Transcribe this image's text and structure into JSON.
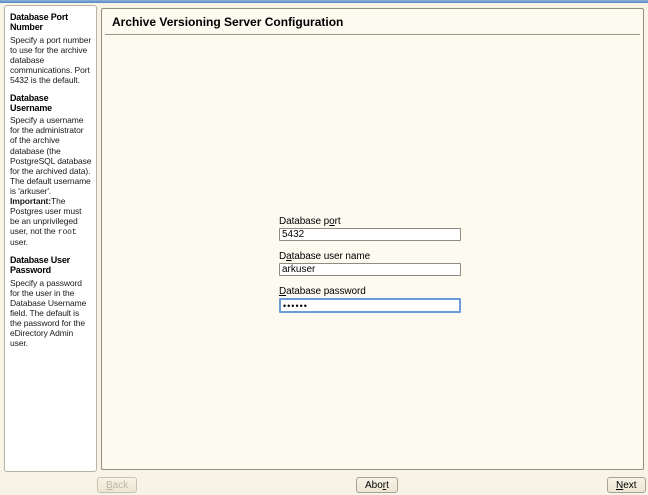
{
  "window": {
    "title": "Archive Versioning Server Configuration"
  },
  "colors": {
    "accent_blue": "#5585c0",
    "focus_border": "#6f9bdc",
    "panel_background": "#fdfaf0",
    "window_background": "#f7f3e7"
  },
  "sidebar": {
    "sections": [
      {
        "heading": "Database Port Number",
        "body": "Specify a port number to use for the archive database communications. Port 5432 is the default."
      },
      {
        "heading": "Database Username",
        "body_1": "Specify a username for the administrator of the archive database (the PostgreSQL database for the archived data). The default username is 'arkuser'. ",
        "important_label": "Important:",
        "body_2": "The Postgres user must be an unprivileged user, not the ",
        "code_word": "root",
        "body_3": " user."
      },
      {
        "heading": "Database User Password",
        "body": "Specify a password for the user in the Database Username field. The default is the password for the eDirectory Admin user."
      }
    ]
  },
  "form": {
    "port": {
      "label_pre": "Database p",
      "label_mnemonic": "o",
      "label_post": "rt",
      "value": "5432"
    },
    "username": {
      "label_pre": "D",
      "label_mnemonic": "a",
      "label_post": "tabase user name",
      "value": "arkuser"
    },
    "password": {
      "label_pre": "",
      "label_mnemonic": "D",
      "label_post": "atabase password",
      "value": "******"
    }
  },
  "buttons": {
    "back": {
      "pre": "",
      "mnemonic": "B",
      "post": "ack"
    },
    "abort": {
      "pre": "Abo",
      "mnemonic": "r",
      "post": "t"
    },
    "next": {
      "pre": "",
      "mnemonic": "N",
      "post": "ext"
    }
  }
}
